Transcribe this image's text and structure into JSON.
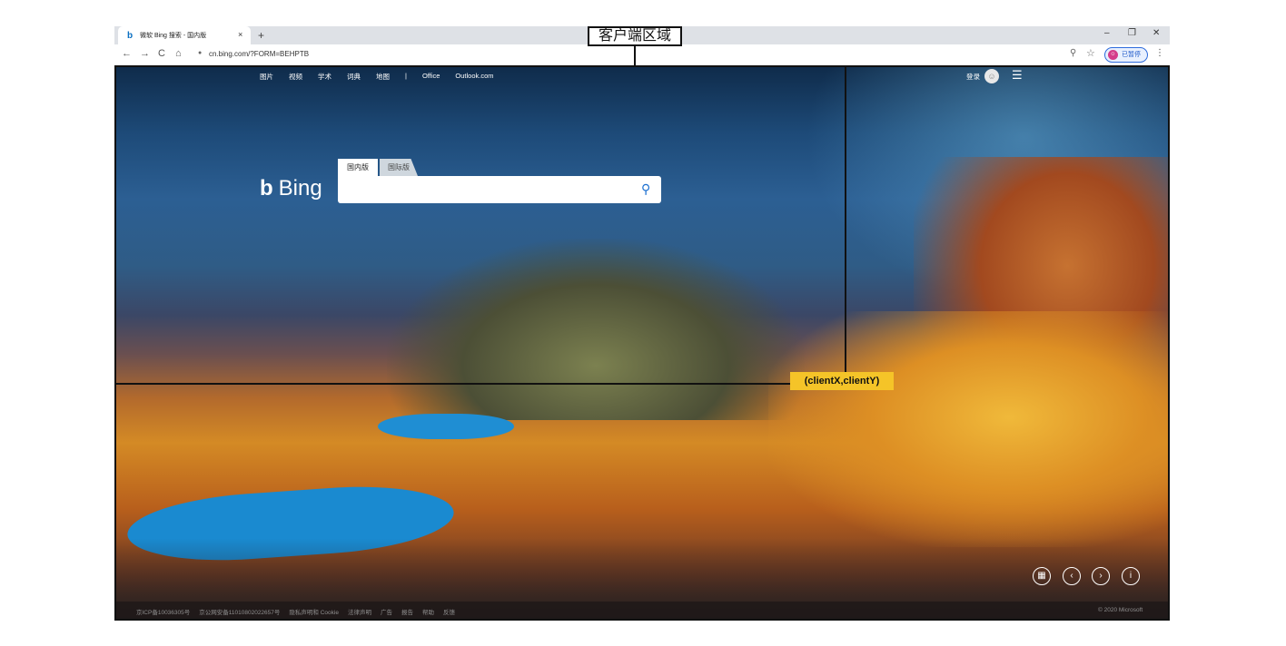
{
  "browser": {
    "tab_title": "微软 Bing 搜索 - 国内版",
    "tab_favicon": "b",
    "close_tab": "×",
    "new_tab": "+",
    "window_controls": [
      "–",
      "❐",
      "✕"
    ],
    "nav": {
      "back": "←",
      "forward": "→",
      "reload": "C",
      "home": "⌂"
    },
    "url": "cn.bing.com/?FORM=BEHPTB",
    "profile_label": "已暂停",
    "icons": [
      "lock-icon",
      "zoom-icon",
      "star-icon",
      "menu-dots-icon"
    ]
  },
  "bing": {
    "topnav": [
      "图片",
      "视频",
      "学术",
      "词典",
      "地图",
      "|",
      "Office",
      "Outlook.com"
    ],
    "signin": "登录",
    "logo_text": "Bing",
    "logo_mark": "b",
    "scope_tabs": [
      "国内版",
      "国际版"
    ],
    "search_placeholder": "",
    "carousel_buttons": [
      "▦",
      "‹",
      "›",
      "i"
    ],
    "footer_links": [
      "京ICP备10036305号",
      "京公网安备11010802022657号",
      "隐私声明和 Cookie",
      "法律声明",
      "广告",
      "报告",
      "帮助",
      "反馈"
    ],
    "copyright": "© 2020 Microsoft"
  },
  "annotation": {
    "client_area_label": "客户端区域",
    "coordinate_label": "(clientX,clientY)",
    "colors": {
      "label_bg": "#f5c428",
      "line": "#111111"
    }
  }
}
